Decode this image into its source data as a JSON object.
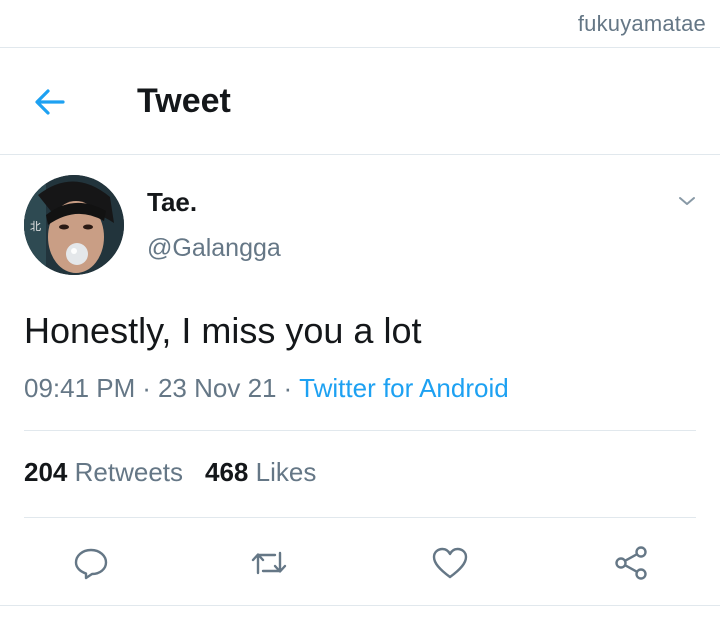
{
  "watermark": "fukuyamatae",
  "header": {
    "title": "Tweet",
    "back_icon": "arrow-left-icon"
  },
  "tweet": {
    "display_name": "Tae.",
    "handle": "@Galangga",
    "text": "Honestly, I miss you a lot",
    "time": "09:41 PM",
    "separator": "·",
    "date": "23 Nov 21",
    "source": "Twitter for Android",
    "retweets_count": "204",
    "retweets_label": "Retweets",
    "likes_count": "468",
    "likes_label": "Likes"
  },
  "actions": [
    "reply-icon",
    "retweet-icon",
    "like-icon",
    "share-icon"
  ],
  "colors": {
    "accent": "#1da1f2",
    "text": "#14171a",
    "secondary": "#657786",
    "divider": "#e1e8ed"
  }
}
